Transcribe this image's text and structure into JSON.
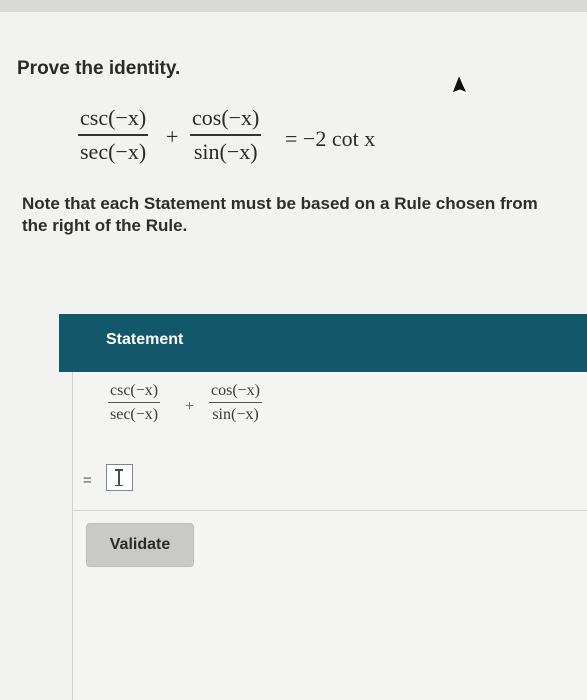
{
  "prompt": "Prove the identity.",
  "identity": {
    "term1": {
      "numerator": "csc(−x)",
      "denominator": "sec(−x)"
    },
    "plus": "+",
    "term2": {
      "numerator": "cos(−x)",
      "denominator": "sin(−x)"
    },
    "rhs": "= −2 cot x"
  },
  "note": "Note that each Statement must be based on a Rule chosen from\nthe right of the Rule.",
  "table": {
    "header": "Statement",
    "statement_row": {
      "term1": {
        "numerator": "csc(−x)",
        "denominator": "sec(−x)"
      },
      "plus": "+",
      "term2": {
        "numerator": "cos(−x)",
        "denominator": "sin(−x)"
      }
    },
    "next_row": {
      "equals": "=",
      "answer_value": ""
    }
  },
  "validate_label": "Validate",
  "colors": {
    "header_bg": "#13586a",
    "header_text": "#ffffff",
    "button_bg": "#c9cac8"
  }
}
